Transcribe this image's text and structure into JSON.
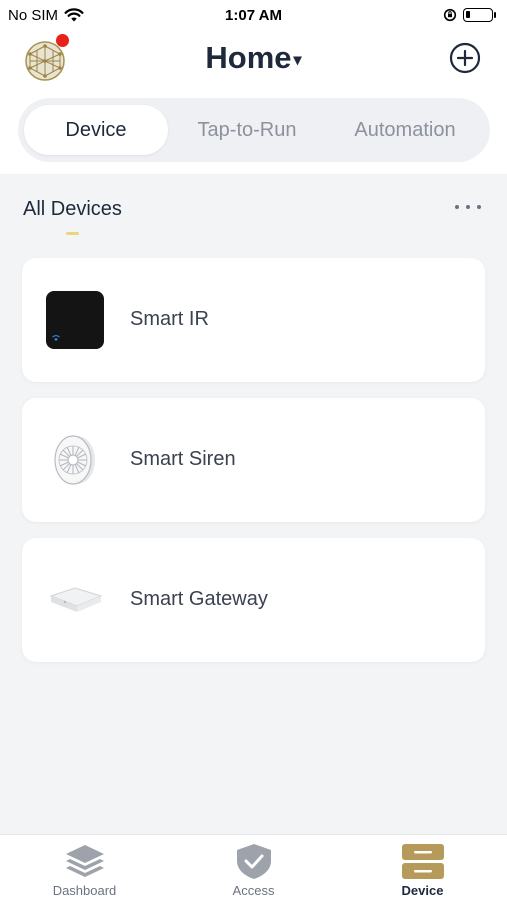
{
  "status_bar": {
    "carrier": "No SIM",
    "time": "1:07 AM"
  },
  "header": {
    "title": "Home",
    "caret": "▾"
  },
  "tabs": [
    {
      "label": "Device",
      "active": true
    },
    {
      "label": "Tap-to-Run",
      "active": false
    },
    {
      "label": "Automation",
      "active": false
    }
  ],
  "section": {
    "title": "All Devices"
  },
  "devices": [
    {
      "name": "Smart IR",
      "icon": "smart-ir-device-icon"
    },
    {
      "name": "Smart Siren",
      "icon": "smart-siren-device-icon"
    },
    {
      "name": "Smart Gateway",
      "icon": "smart-gateway-device-icon"
    }
  ],
  "bottom_nav": [
    {
      "label": "Dashboard",
      "icon": "layers-icon",
      "active": false
    },
    {
      "label": "Access",
      "icon": "shield-check-icon",
      "active": false
    },
    {
      "label": "Device",
      "icon": "device-icon",
      "active": true
    }
  ],
  "colors": {
    "accent": "#b59a5a",
    "notification": "#e8221b",
    "title": "#1e2a3c"
  }
}
